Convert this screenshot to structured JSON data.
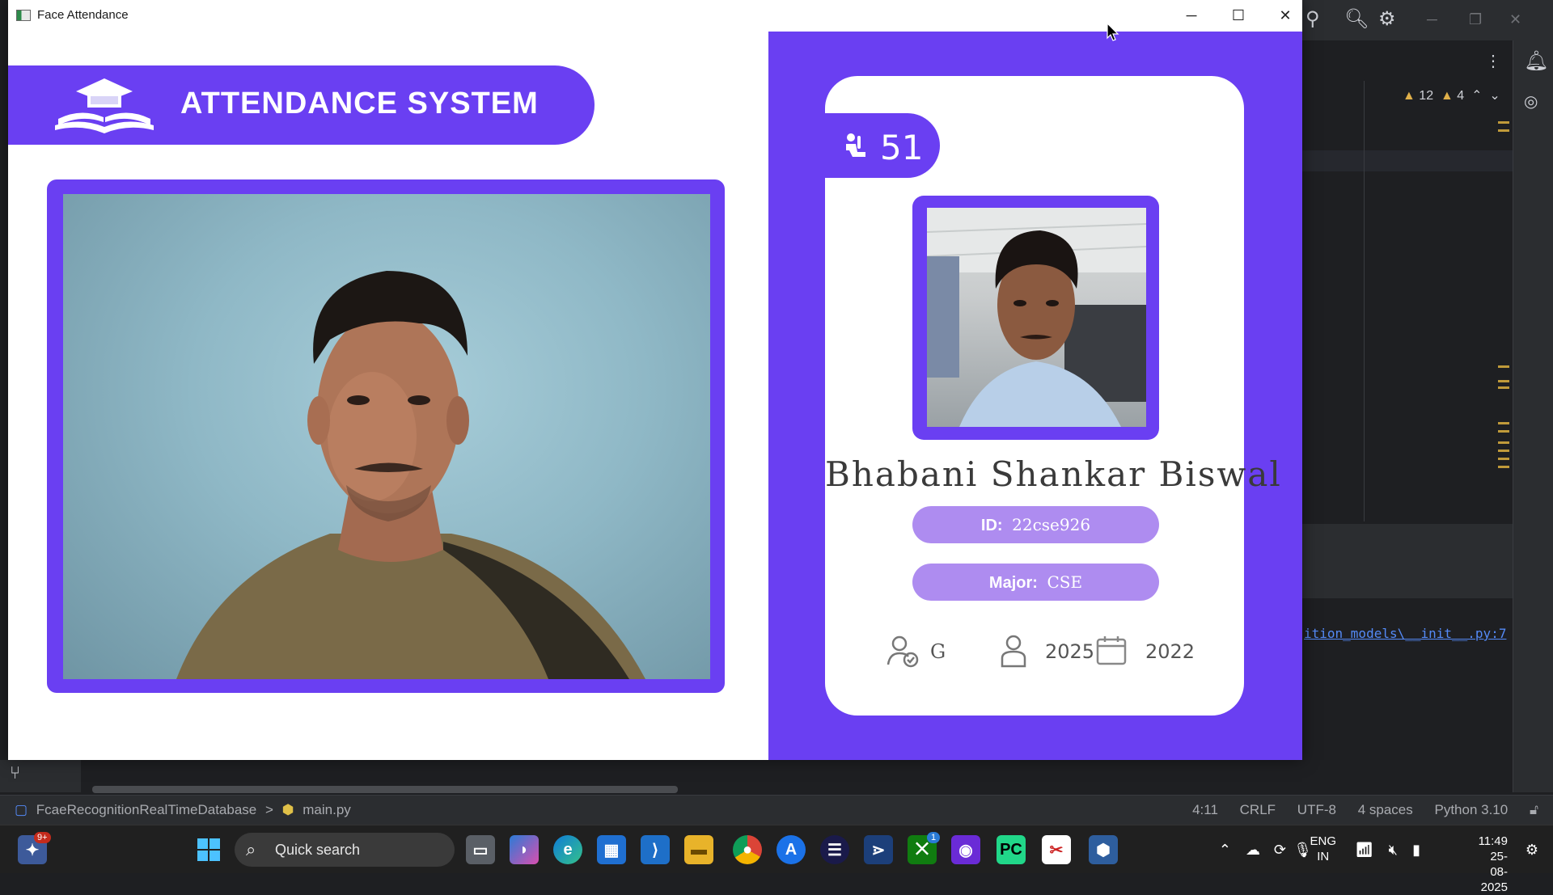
{
  "window": {
    "title": "Face Attendance",
    "controls": {
      "minimize": "─",
      "maximize": "☐",
      "close": "✕"
    }
  },
  "header": {
    "title": "ATTENDANCE SYSTEM",
    "logo_icon": "graduation-cap-book-icon"
  },
  "student": {
    "total_attendance": "51",
    "name": "Bhabani Shankar Biswal",
    "id_label": "ID:",
    "id_value": "22cse926",
    "major_label": "Major:",
    "major_value": "CSE",
    "standing": "G",
    "year": "2025",
    "starting_year": "2022"
  },
  "colors": {
    "accent": "#6a3ff2",
    "pill": "#ae8cf0"
  },
  "ide": {
    "warnings_a": "12",
    "warnings_b": "4",
    "error_link": "ition_models\\__init__.py:7",
    "status": {
      "project": "FcaeRecognitionRealTimeDatabase",
      "separator": ">",
      "file": "main.py",
      "position": "4:11",
      "line_sep": "CRLF",
      "encoding": "UTF-8",
      "indent": "4 spaces",
      "interpreter": "Python 3.10"
    }
  },
  "taskbar": {
    "search_placeholder": "Quick search",
    "notification_badge": "9+",
    "xbox_badge": "1",
    "lang_top": "ENG",
    "lang_bottom": "IN",
    "time": "11:49",
    "date": "25-08-2025"
  }
}
